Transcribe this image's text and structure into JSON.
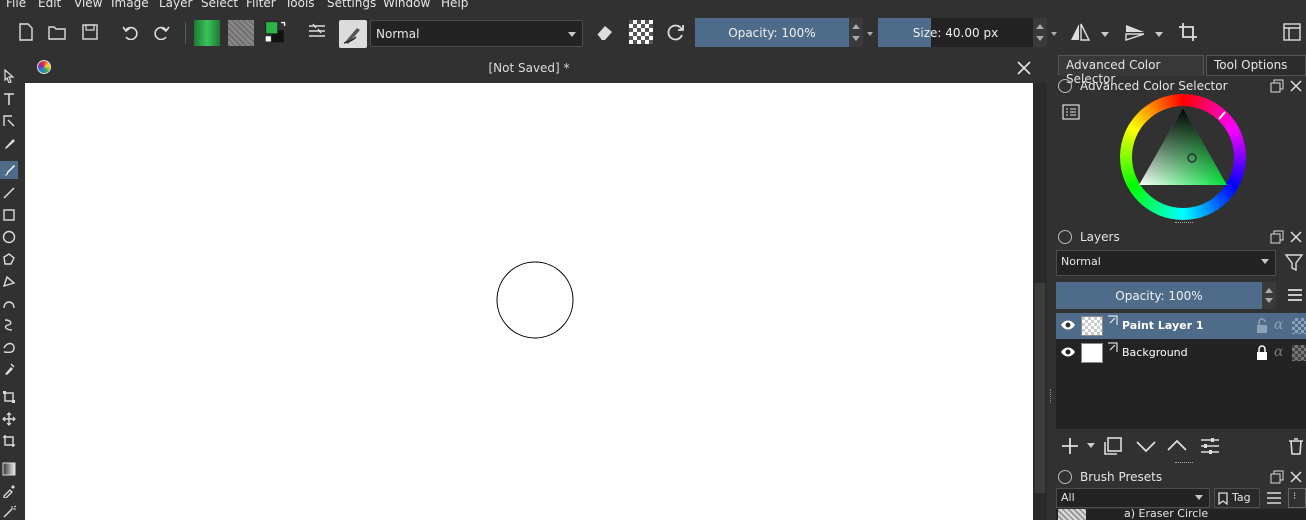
{
  "menu": [
    "File",
    "Edit",
    "View",
    "Image",
    "Layer",
    "Select",
    "Filter",
    "Tools",
    "Settings",
    "Window",
    "Help"
  ],
  "toolbar": {
    "blend_mode": "Normal",
    "opacity_label": "Opacity:  100%",
    "opacity_value": 1.0,
    "size_label": "Size:  40.00 px",
    "size_value": 40.0
  },
  "document": {
    "title": "[Not Saved]  *"
  },
  "dock_tabs": [
    "Advanced Color Selector",
    "Tool Options"
  ],
  "color_selector": {
    "title": "Advanced Color Selector",
    "current_color": "#2db34a"
  },
  "layers": {
    "title": "Layers",
    "blend_mode": "Normal",
    "opacity_label": "Opacity:  100%",
    "items": [
      {
        "name": "Paint Layer 1",
        "selected": true
      },
      {
        "name": "Background",
        "selected": false
      }
    ]
  },
  "brush_presets": {
    "title": "Brush Presets",
    "filter": "All",
    "tag_label": "Tag",
    "first_item": "a) Eraser Circle"
  },
  "colors": {
    "accent": "#4f6b8a",
    "panel": "#313131",
    "field": "#232323"
  }
}
